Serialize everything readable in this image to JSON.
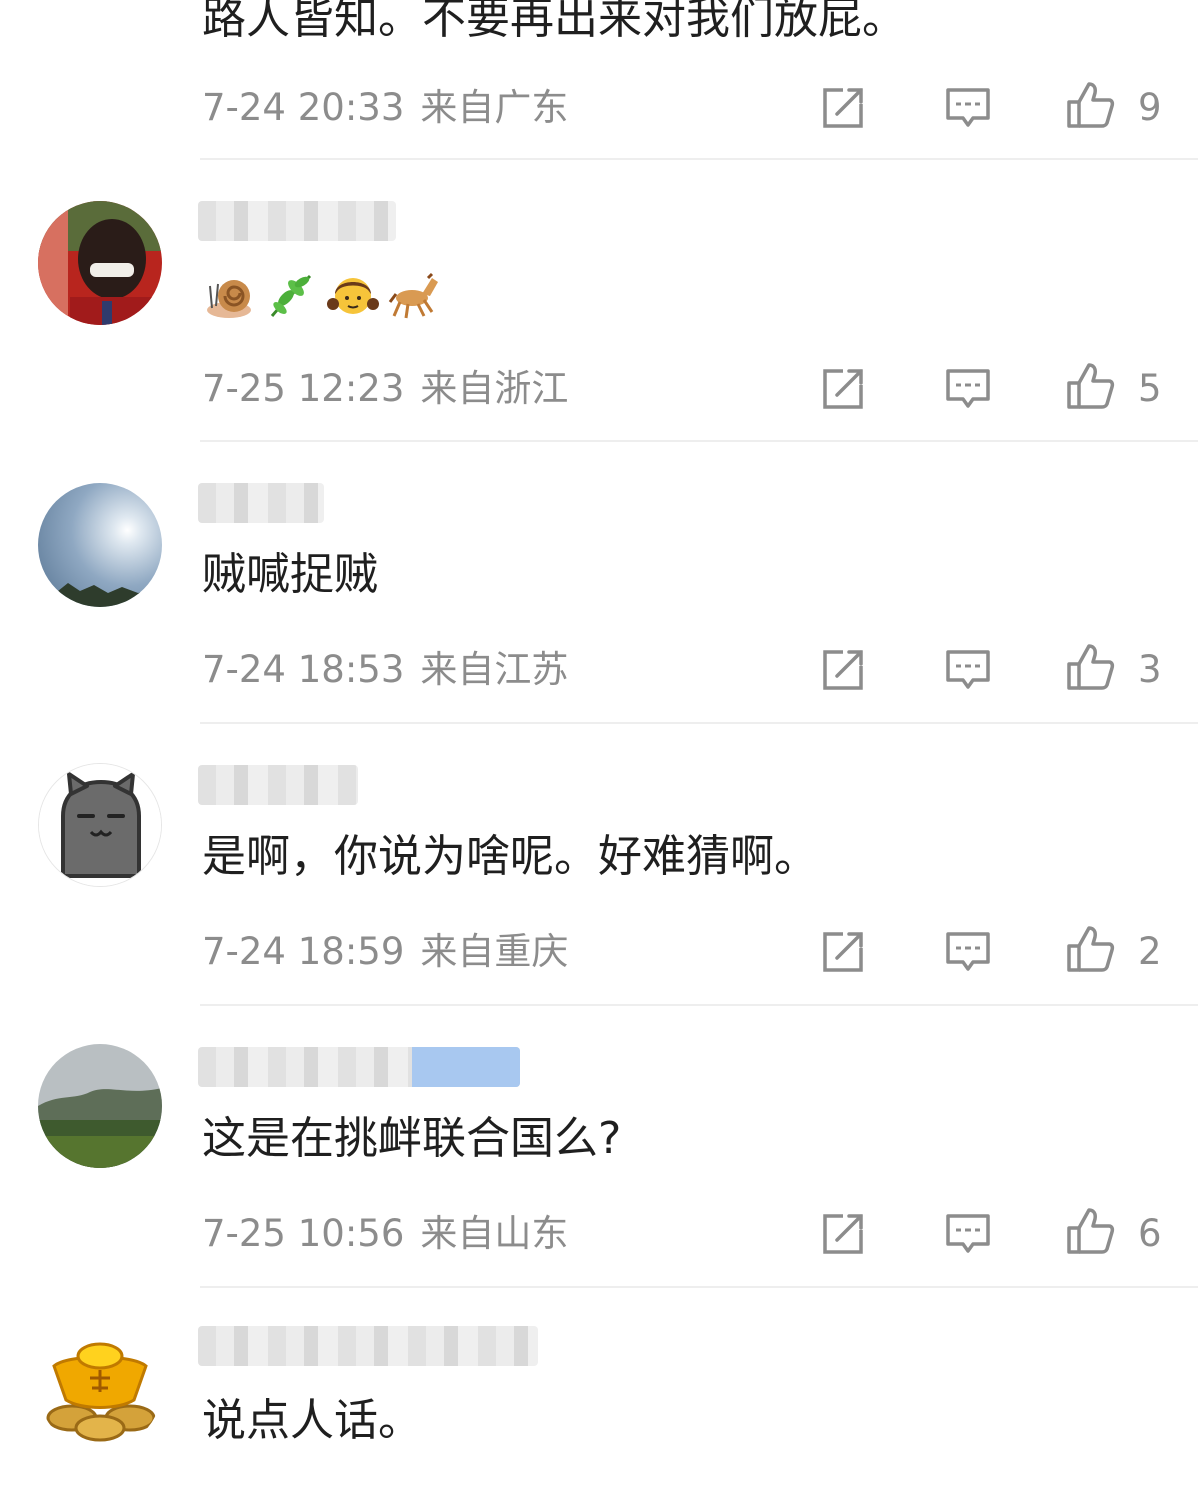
{
  "comments": [
    {
      "username": "",
      "text": "路人皆知。不要再出来对我们放屁。",
      "time": "7-24 20:33",
      "location": "来自广东",
      "likes": "9",
      "avatar": "none"
    },
    {
      "username": "",
      "text": "",
      "emojis": [
        "snail-emoji",
        "herb-emoji",
        "girl-emoji",
        "horse-emoji"
      ],
      "time": "7-25 12:23",
      "location": "来自浙江",
      "likes": "5",
      "avatar": "man-photo"
    },
    {
      "username": "",
      "text": "贼喊捉贼",
      "time": "7-24 18:53",
      "location": "来自江苏",
      "likes": "3",
      "avatar": "sky-sun-photo"
    },
    {
      "username": "",
      "text": "是啊，你说为啥呢。好难猜啊。",
      "time": "7-24 18:59",
      "location": "来自重庆",
      "likes": "2",
      "avatar": "cartoon-cat"
    },
    {
      "username": "",
      "text": "这是在挑衅联合国么?",
      "time": "7-25 10:56",
      "location": "来自山东",
      "likes": "6",
      "avatar": "landscape-photo"
    },
    {
      "username": "",
      "text": "说点人话。",
      "time": "",
      "location": "",
      "likes": "",
      "avatar": "gold-ingot"
    }
  ],
  "icons": {
    "share": "share-icon",
    "reply": "reply-icon",
    "like": "thumbs-up-icon"
  },
  "colors": {
    "body_text": "#1f1f1f",
    "meta_text": "#8c8c8c",
    "divider": "#eeeeee"
  }
}
